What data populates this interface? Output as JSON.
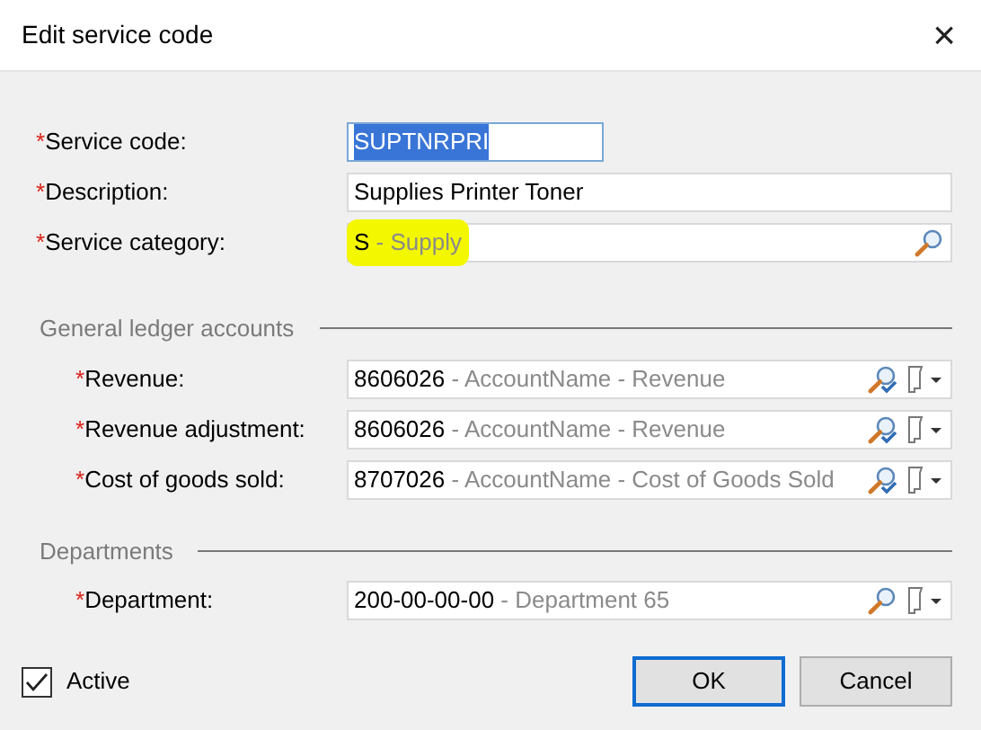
{
  "window": {
    "title": "Edit service code",
    "close": "×"
  },
  "fields": [
    {
      "mark": "*",
      "label": "Service code:",
      "kind": "text",
      "value": "SUPTNRPRI",
      "selected": true,
      "wide": false
    },
    {
      "mark": "*",
      "label": "Description:",
      "kind": "text",
      "value": "Supplies Printer Toner",
      "selected": false,
      "wide": true
    },
    {
      "mark": "*",
      "label": "Service category:",
      "kind": "lookup",
      "code": "S",
      "name": "- Supply",
      "highlighted": true
    }
  ],
  "groups": [
    {
      "title": "General ledger accounts",
      "fields": [
        {
          "mark": "*",
          "label": "Revenue:",
          "kind": "account",
          "code": "8606026",
          "name": "- AccountName - Revenue",
          "highlighted": false
        },
        {
          "mark": "*",
          "label": "Revenue adjustment:",
          "kind": "account",
          "code": "8606026",
          "name": "- AccountName - Revenue",
          "highlighted": false
        },
        {
          "mark": "*",
          "label": "Cost of goods sold:",
          "kind": "account",
          "code": "8707026",
          "name": "- AccountName - Cost of Goods Sold",
          "highlighted": false
        }
      ]
    },
    {
      "title": "Departments",
      "fields": [
        {
          "mark": "*",
          "label": "Department:",
          "kind": "department",
          "code": "200-00-00-00",
          "name": "- Department 65",
          "highlighted": false
        }
      ]
    }
  ],
  "active": {
    "label": "Active",
    "checked": true
  },
  "buttons": [
    {
      "label": "OK",
      "default": true
    },
    {
      "label": "Cancel",
      "default": false
    }
  ]
}
